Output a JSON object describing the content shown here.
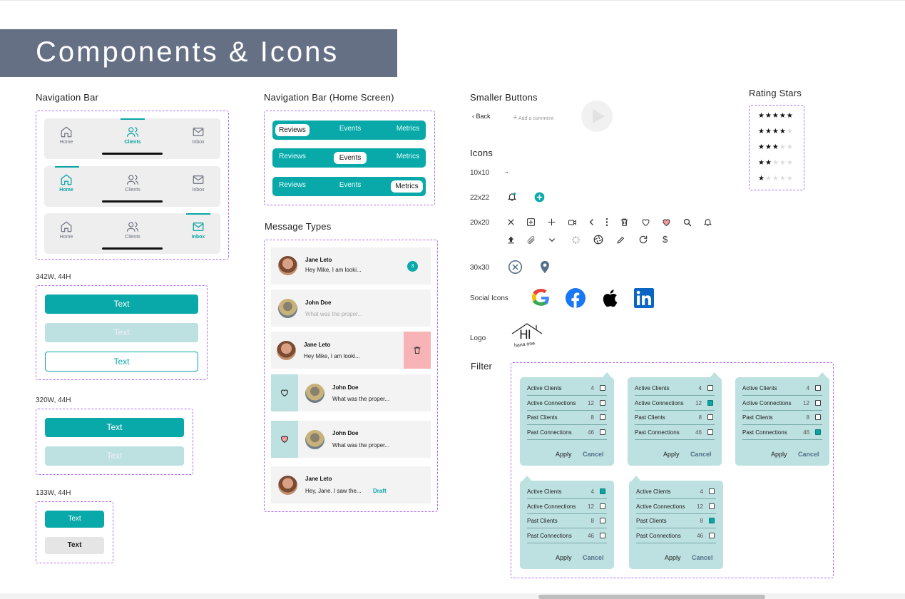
{
  "page": {
    "title": "Components & Icons"
  },
  "sections": {
    "nav_bar": "Navigation Bar",
    "nav_home": "Navigation Bar (Home Screen)",
    "smaller_buttons": "Smaller Buttons",
    "rating": "Rating Stars",
    "message_types": "Message Types",
    "icons": "Icons",
    "social": "Social Icons",
    "logo": "Logo",
    "filter": "Filter"
  },
  "nav": {
    "home": "Home",
    "clients": "Clients",
    "inbox": "Inbox"
  },
  "tabs": {
    "reviews": "Reviews",
    "events": "Events",
    "metrics": "Metrics"
  },
  "sizes": {
    "s1": "342W, 44H",
    "s2": "320W, 44H",
    "s3": "133W, 44H"
  },
  "buttons": {
    "text": "Text"
  },
  "smaller": {
    "back": "Back",
    "add_comment": "Add a comment"
  },
  "icon_sizes": {
    "i10": "10x10",
    "i22": "22x22",
    "i20": "20x20",
    "i30": "30x30"
  },
  "messages": [
    {
      "name": "Jane Leto",
      "text": "Hey Mike, I am looki...",
      "badge": "3"
    },
    {
      "name": "John Doe",
      "text": "What was the proper..."
    },
    {
      "name": "Jane Leto",
      "text": "Hey Mike, I am looki..."
    },
    {
      "name": "John Doe",
      "text": "What was the proper..."
    },
    {
      "name": "John Doe",
      "text": "What was the proper..."
    },
    {
      "name": "Jane Leto",
      "text": "Hey, Jane. I saw the...",
      "tag": "Draft"
    }
  ],
  "logo": {
    "mark": "HI",
    "sub": "hana one"
  },
  "filter": {
    "items": [
      "Active Clients",
      "Active Connections",
      "Past Clients",
      "Past Connections"
    ],
    "counts": [
      "4",
      "12",
      "8",
      "46"
    ],
    "apply": "Apply",
    "cancel": "Cancel",
    "checked": [
      [
        false,
        false,
        false,
        false
      ],
      [
        false,
        true,
        false,
        false
      ],
      [
        false,
        false,
        false,
        true
      ],
      [
        true,
        false,
        false,
        false
      ],
      [
        false,
        false,
        true,
        false
      ]
    ]
  },
  "colors": {
    "accent": "#0aa9a9",
    "banner": "#667085",
    "light": "#bde0e0",
    "danger": "#f7b3b5"
  }
}
